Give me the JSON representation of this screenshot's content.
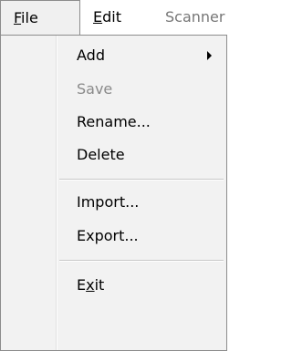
{
  "menubar": {
    "file": {
      "prefix": "",
      "mnemonic": "F",
      "rest": "ile"
    },
    "edit": {
      "prefix": "",
      "mnemonic": "E",
      "rest": "dit"
    },
    "scanner": {
      "label": "Scanner"
    }
  },
  "file_menu": {
    "items": [
      {
        "label": "Add",
        "has_submenu": true,
        "enabled": true
      },
      {
        "label": "Save",
        "enabled": false
      },
      {
        "label": "Rename...",
        "enabled": true
      },
      {
        "label": "Delete",
        "enabled": true
      },
      {
        "label": "Import...",
        "enabled": true
      },
      {
        "label": "Export...",
        "enabled": true
      }
    ],
    "exit": {
      "prefix": "E",
      "mnemonic": "x",
      "rest": "it"
    }
  },
  "colors": {
    "menu_background": "#f2f2f2",
    "border": "#8c8c8c",
    "disabled_text": "#8a8a8a",
    "separator": "#c8c8c8"
  }
}
